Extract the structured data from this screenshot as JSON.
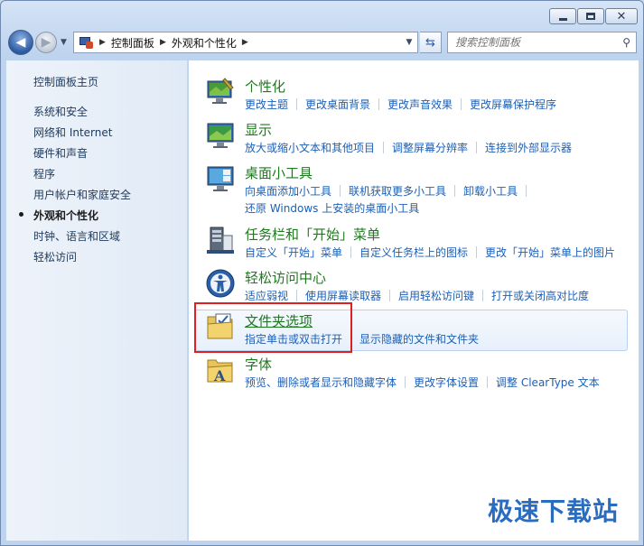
{
  "nav": {
    "back_glyph": "◀",
    "forward_glyph": "▶",
    "breadcrumbs": [
      "控制面板",
      "外观和个性化"
    ],
    "search_placeholder": "搜索控制面板"
  },
  "sidebar": {
    "items": [
      {
        "label": "控制面板主页",
        "active": false
      },
      {
        "label": "系统和安全",
        "active": false
      },
      {
        "label": "网络和 Internet",
        "active": false
      },
      {
        "label": "硬件和声音",
        "active": false
      },
      {
        "label": "程序",
        "active": false
      },
      {
        "label": "用户帐户和家庭安全",
        "active": false
      },
      {
        "label": "外观和个性化",
        "active": true
      },
      {
        "label": "时钟、语言和区域",
        "active": false
      },
      {
        "label": "轻松访问",
        "active": false
      }
    ]
  },
  "categories": [
    {
      "title": "个性化",
      "icon": "personalization-icon",
      "links": [
        "更改主题",
        "更改桌面背景",
        "更改声音效果",
        "更改屏幕保护程序"
      ]
    },
    {
      "title": "显示",
      "icon": "display-icon",
      "links": [
        "放大或缩小文本和其他项目",
        "调整屏幕分辨率",
        "连接到外部显示器"
      ]
    },
    {
      "title": "桌面小工具",
      "icon": "gadgets-icon",
      "links": [
        "向桌面添加小工具",
        "联机获取更多小工具",
        "卸载小工具"
      ],
      "links2": [
        "还原 Windows 上安装的桌面小工具"
      ]
    },
    {
      "title": "任务栏和「开始」菜单",
      "icon": "taskbar-icon",
      "links": [
        "自定义「开始」菜单",
        "自定义任务栏上的图标",
        "更改「开始」菜单上的图片"
      ]
    },
    {
      "title": "轻松访问中心",
      "icon": "ease-of-access-icon",
      "links": [
        "适应弱视",
        "使用屏幕读取器",
        "启用轻松访问键",
        "打开或关闭高对比度"
      ]
    },
    {
      "title": "文件夹选项",
      "icon": "folder-options-icon",
      "links": [
        "指定单击或双击打开",
        "显示隐藏的文件和文件夹"
      ]
    },
    {
      "title": "字体",
      "icon": "fonts-icon",
      "links": [
        "预览、删除或者显示和隐藏字体",
        "更改字体设置",
        "调整 ClearType 文本"
      ]
    }
  ],
  "watermark": "极速下载站",
  "colors": {
    "link": "#1d5fb4",
    "title": "#1e7a1e",
    "highlight_border": "#e02020"
  }
}
